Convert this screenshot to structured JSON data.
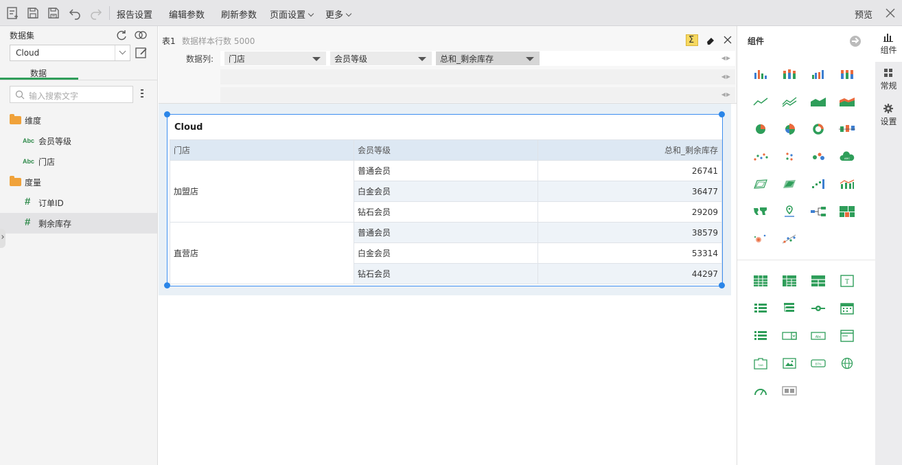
{
  "toolbar": {
    "menus": [
      {
        "label": "报告设置",
        "caret": false
      },
      {
        "label": "编辑参数",
        "caret": false
      },
      {
        "label": "刷新参数",
        "caret": false
      },
      {
        "label": "页面设置",
        "caret": true
      },
      {
        "label": "更多",
        "caret": true
      }
    ],
    "preview_label": "预览"
  },
  "left": {
    "dataset_label": "数据集",
    "dataset_value": "Cloud",
    "tab_label": "数据",
    "search_placeholder": "输入搜索文字",
    "dimension_folder": "维度",
    "dimensions": [
      "会员等级",
      "门店"
    ],
    "measure_folder": "度量",
    "measures": [
      "订单ID",
      "剩余库存"
    ],
    "selected_item": "剩余库存"
  },
  "center": {
    "table_id": "表1",
    "sample_info": "数据样本行数 5000",
    "param_label": "数据列:",
    "columns": [
      "门店",
      "会员等级",
      "总和_剩余库存"
    ],
    "table_title": "Cloud",
    "headers": [
      "门店",
      "会员等级",
      "总和_剩余库存"
    ],
    "groups": [
      {
        "store": "加盟店",
        "rows": [
          {
            "level": "普通会员",
            "value": "26741"
          },
          {
            "level": "白金会员",
            "value": "36477"
          },
          {
            "level": "钻石会员",
            "value": "29209"
          }
        ]
      },
      {
        "store": "直营店",
        "rows": [
          {
            "level": "普通会员",
            "value": "38579"
          },
          {
            "level": "白金会员",
            "value": "53314"
          },
          {
            "level": "钻石会员",
            "value": "44297"
          }
        ]
      }
    ]
  },
  "right": {
    "title": "组件",
    "chart_icons": [
      "bar-chart-icon",
      "stacked-bar-chart-icon",
      "grouped-bar-chart-icon",
      "percent-bar-chart-icon",
      "line-chart-icon",
      "multi-line-chart-icon",
      "area-chart-icon",
      "stacked-area-chart-icon",
      "pie-chart-icon",
      "rose-pie-chart-icon",
      "donut-chart-icon",
      "box-plot-icon",
      "scatter-chart-icon",
      "dot-chart-icon",
      "bubble-chart-icon",
      "word-cloud-icon",
      "radar-chart-icon",
      "filled-radar-chart-icon",
      "step-bar-chart-icon",
      "combo-chart-icon",
      "world-map-icon",
      "map-marker-icon",
      "tree-chart-icon",
      "treemap-icon",
      "heatmap-icon",
      "scatter-line-icon"
    ],
    "component_icons": [
      "table-icon",
      "crosstab-icon",
      "freestyle-table-icon",
      "text-icon",
      "list-filter-icon",
      "tree-filter-icon",
      "slider-icon",
      "calendar-icon",
      "list-icon",
      "dropdown-icon",
      "text-input-icon",
      "header-box-icon",
      "tab-icon",
      "image-icon",
      "button-icon",
      "web-icon",
      "gauge-icon",
      "tab-container-icon"
    ],
    "tabs": [
      "组件",
      "常规",
      "设置"
    ]
  },
  "colors": {
    "accent_green": "#2f8a4b",
    "chart_blue": "#3d7fd1",
    "chart_orange": "#ea6b3d",
    "chart_green": "#2f9e5a",
    "selection_blue": "#2a85e8"
  }
}
